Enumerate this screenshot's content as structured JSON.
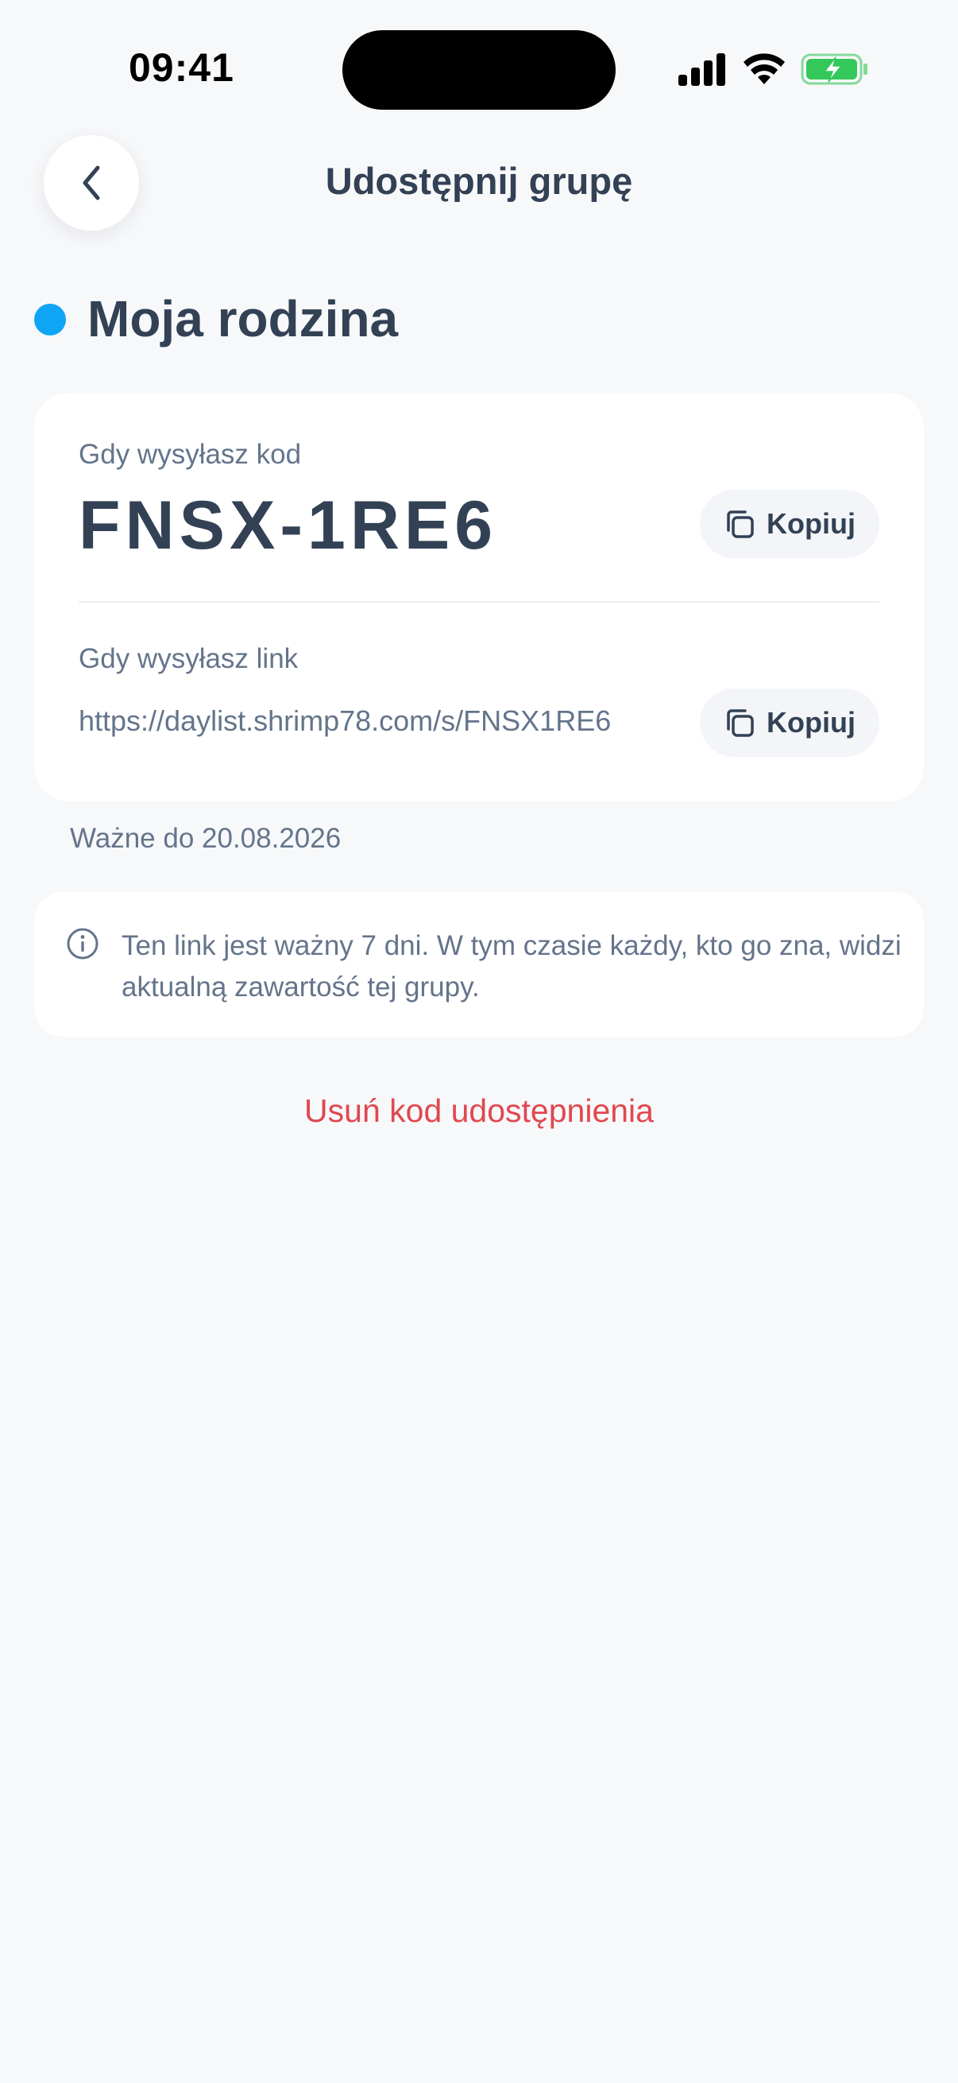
{
  "status_bar": {
    "time": "09:41",
    "icons": [
      "signal-icon",
      "wifi-icon",
      "battery-charging-icon"
    ]
  },
  "header": {
    "title": "Udostępnij grupę",
    "back_icon": "chevron-left-icon"
  },
  "group": {
    "name": "Moja rodzina",
    "color": "#0ea5f5"
  },
  "share_card": {
    "code_label": "Gdy wysyłasz kod",
    "code": "FNSX-1RE6",
    "copy_code_label": "Kopiuj",
    "link_label": "Gdy wysyłasz link",
    "link": "https://daylist.shrimp78.com/s/FNSX1RE6",
    "copy_link_label": "Kopiuj"
  },
  "valid_until": "Ważne do 20.08.2026",
  "info": {
    "text": "Ten link jest ważny 7 dni. W tym czasie każdy, kto go zna, widzi aktualną zawartość tej grupy."
  },
  "remove_label": "Usuń kod udostępnienia",
  "colors": {
    "background": "#f7f8fa",
    "text": "#334155",
    "muted": "#64748b",
    "danger": "#e0484f",
    "battery": "#34c759"
  }
}
